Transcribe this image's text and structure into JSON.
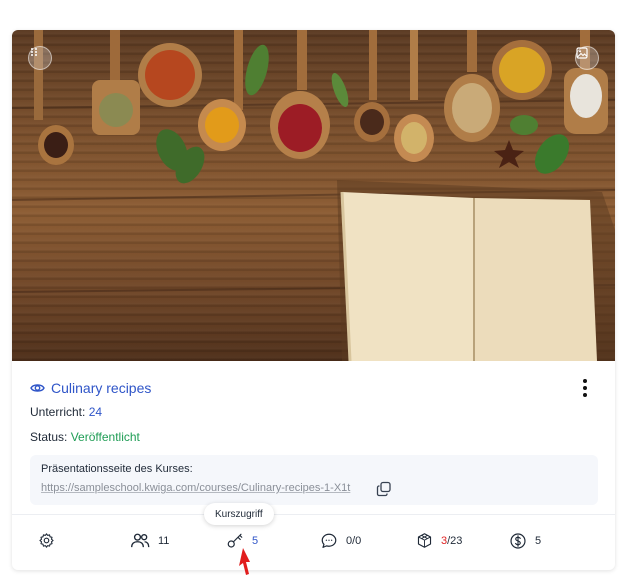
{
  "course": {
    "title": "Culinary recipes",
    "lessons_label": "Unterricht:",
    "lessons_value": "24",
    "status_label": "Status:",
    "status_value": "Veröffentlicht"
  },
  "presentation": {
    "label": "Präsentationsseite des Kurses:",
    "url": "https://sampleschool.kwiga.com/courses/Culinary-recipes-1-X1t"
  },
  "stats": {
    "users": "11",
    "access": "5",
    "comments": "0/0",
    "tests_done": "3",
    "tests_total": "/23",
    "payments": "5"
  },
  "tooltip": "Kurszugriff",
  "colors": {
    "accent_blue": "#2f55c8",
    "status_green": "#1f9d55",
    "alert_red": "#e02424"
  },
  "icons": [
    "drag-handle-icon",
    "image-icon",
    "eye-icon",
    "more-vertical-icon",
    "copy-icon",
    "gear-icon",
    "users-icon",
    "key-icon",
    "comment-icon",
    "cube-icon",
    "dollar-icon",
    "cursor-arrow-icon"
  ]
}
